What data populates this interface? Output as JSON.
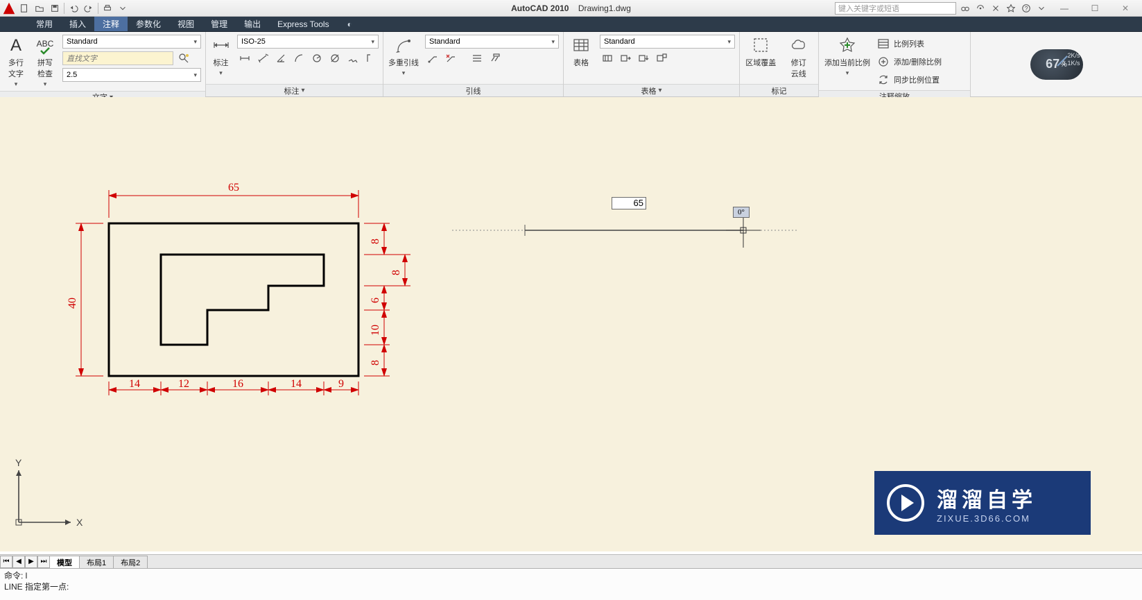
{
  "title": {
    "app": "AutoCAD 2010",
    "file": "Drawing1.dwg"
  },
  "search_placeholder": "键入关键字或短语",
  "menu": {
    "items": [
      "常用",
      "插入",
      "注释",
      "参数化",
      "视图",
      "管理",
      "输出",
      "Express Tools"
    ],
    "active_index": 2
  },
  "ribbon": {
    "text": {
      "title": "文字",
      "mtext": "多行\n文字",
      "spell": "拼写\n检查",
      "style_combo": "Standard",
      "find_placeholder": "直找文字",
      "height": "2.5"
    },
    "dim": {
      "title": "标注",
      "big": "标注",
      "style_combo": "ISO-25"
    },
    "leader": {
      "title": "引线",
      "big": "多重引线",
      "style_combo": "Standard"
    },
    "table": {
      "title": "表格",
      "big": "表格",
      "style_combo": "Standard"
    },
    "mark": {
      "title": "标记",
      "wipeout": "区域覆盖",
      "revcloud": "修订\n云线"
    },
    "scale": {
      "title": "注释缩放",
      "add": "添加当前比例",
      "list": "比例列表",
      "adddel": "添加/删除比例",
      "sync": "同步比例位置"
    },
    "gauge": {
      "pct": "67",
      "sub": "%",
      "r1": "2K/s",
      "r2": "1.1K/s"
    }
  },
  "drawing": {
    "dims": {
      "top": "65",
      "left": "40",
      "right": [
        "8",
        "8",
        "6",
        "10",
        "8"
      ],
      "bottom": [
        "14",
        "12",
        "16",
        "14",
        "9"
      ]
    },
    "live_len": "65",
    "live_ang": "0°"
  },
  "ucs": {
    "x": "X",
    "y": "Y"
  },
  "watermark": {
    "l1": "溜溜自学",
    "l2": "ZIXUE.3D66.COM"
  },
  "sheets": {
    "tabs": [
      "模型",
      "布局1",
      "布局2"
    ],
    "active": 0
  },
  "cmd": {
    "l1": "命令: l",
    "l2": "LINE 指定第一点:"
  }
}
